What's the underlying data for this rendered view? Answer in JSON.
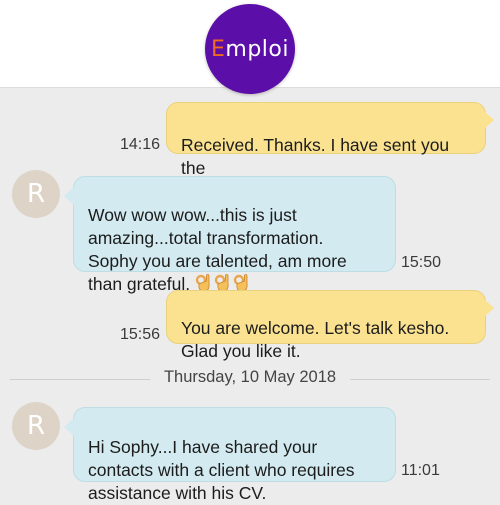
{
  "header": {
    "logo_first_letter": "E",
    "logo_rest": "mploi",
    "brand_accent_color": "#f06a1f",
    "brand_bg_color": "#5b0fa8"
  },
  "messages": [
    {
      "direction": "outgoing",
      "text": "Received. Thanks. I have sent you the\nCV",
      "time": "14:16"
    },
    {
      "direction": "incoming",
      "avatar": "R",
      "text": "Wow wow wow...this is just\namazing...total transformation.\nSophy you are talented, am more\nthan grateful.",
      "emoji_icons": [
        "ok-hand-icon",
        "ok-hand-icon",
        "ok-hand-icon"
      ],
      "time": "15:50"
    },
    {
      "direction": "outgoing",
      "text": "You are welcome. Let's talk kesho.\nGlad you like it.",
      "time": "15:56"
    },
    {
      "direction": "incoming",
      "avatar": "R",
      "text": "Hi Sophy...I have shared your\ncontacts with a client who requires\nassistance with his CV.",
      "time": "11:01"
    }
  ],
  "date_separator": "Thursday, 10 May 2018",
  "colors": {
    "outgoing_bubble": "#fae291",
    "incoming_bubble": "#d2eaf0",
    "avatar": "#ddd3c6",
    "background": "#ececec"
  }
}
